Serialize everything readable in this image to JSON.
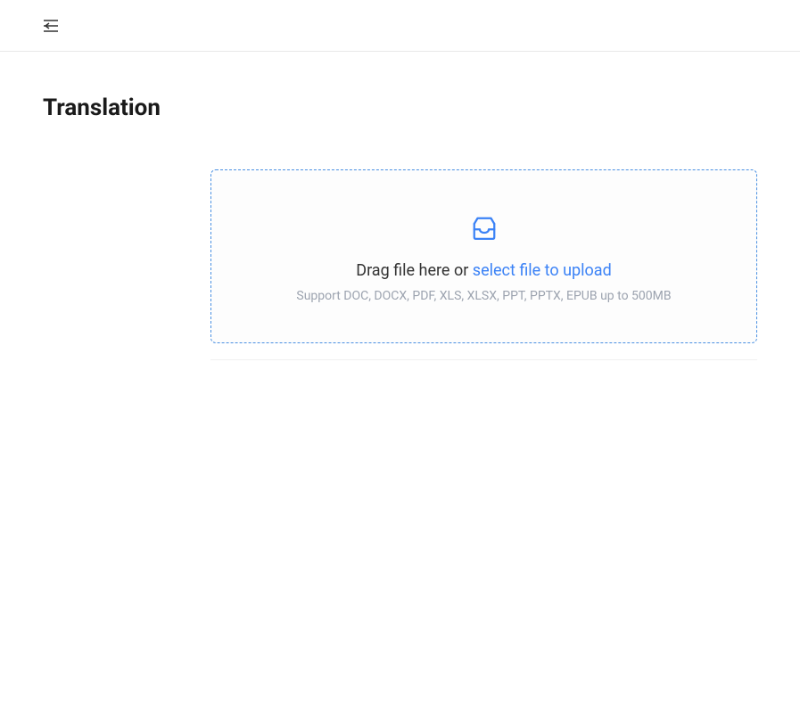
{
  "page": {
    "title": "Translation"
  },
  "upload": {
    "drag_text": "Drag file here or ",
    "select_text": "select file to upload",
    "hint": "Support DOC, DOCX, PDF, XLS, XLSX, PPT, PPTX, EPUB up to 500MB"
  }
}
